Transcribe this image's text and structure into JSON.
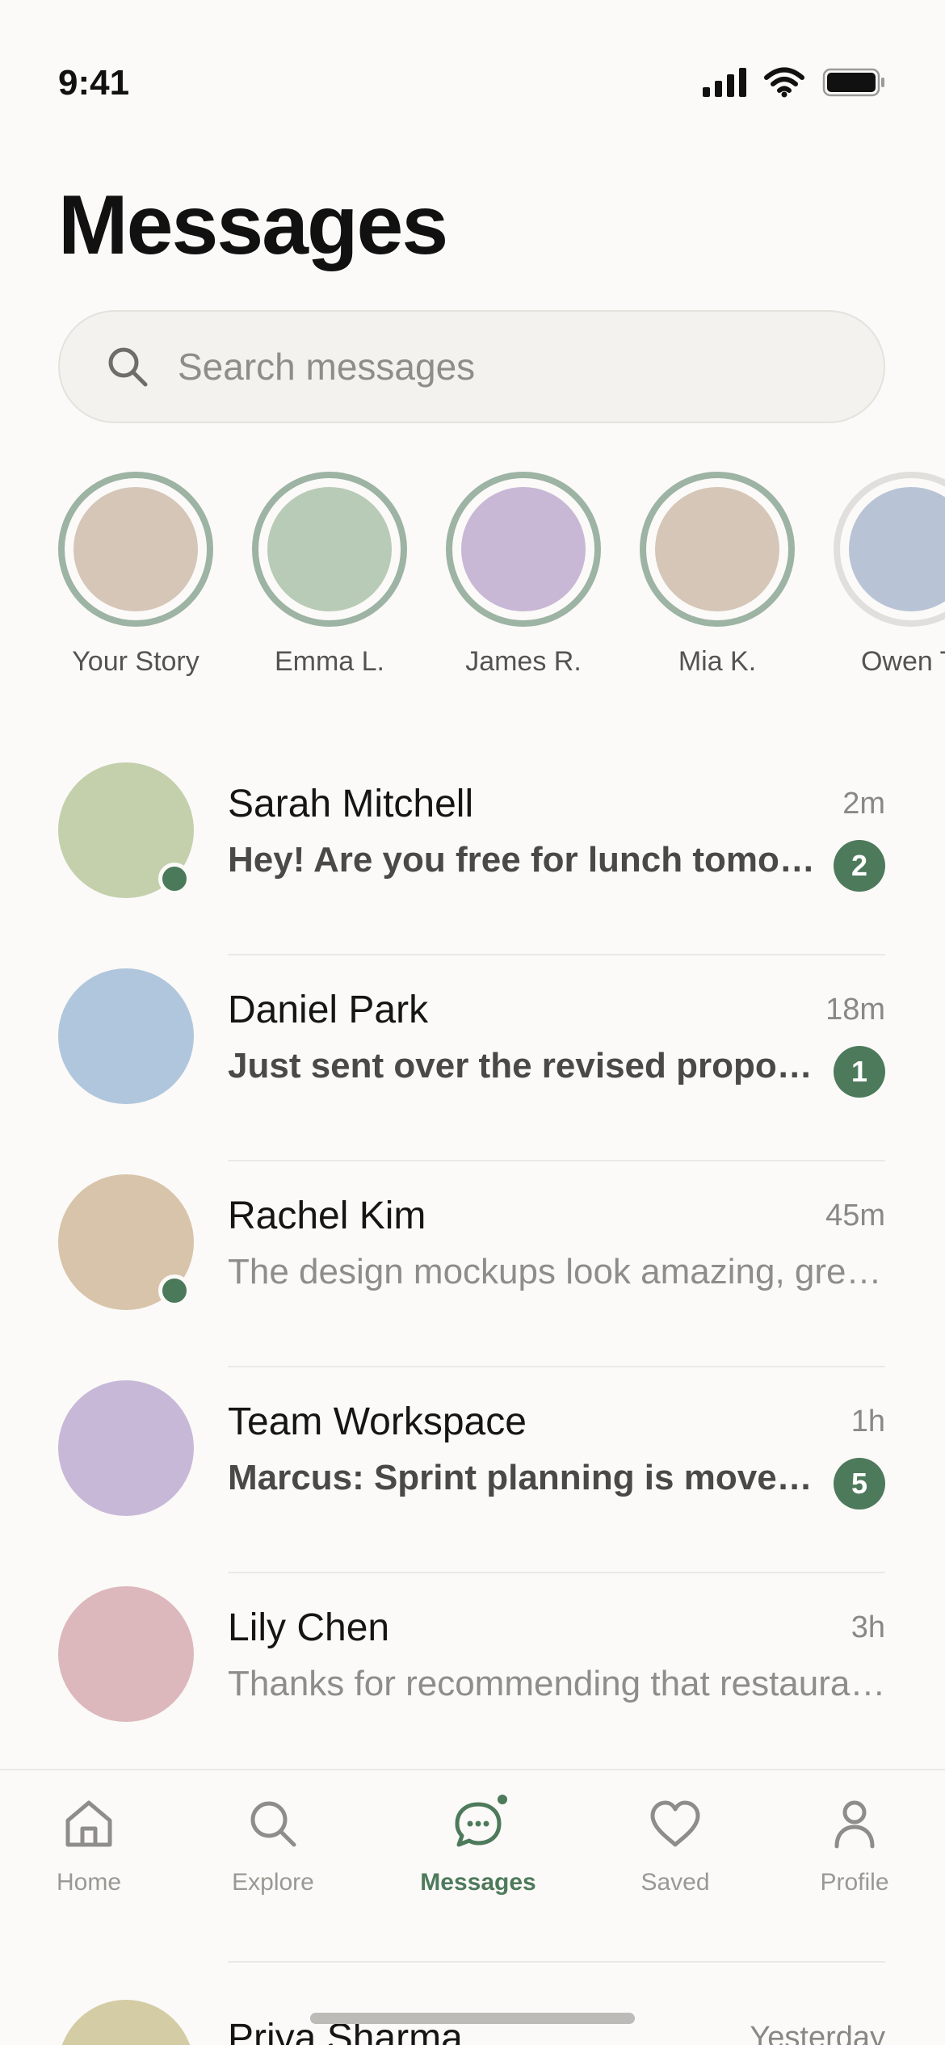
{
  "status_bar": {
    "time": "9:41"
  },
  "header": {
    "title": "Messages"
  },
  "search": {
    "placeholder": "Search messages"
  },
  "stories": [
    {
      "name": "Your Story",
      "color": "#d6c6b8",
      "seen": false
    },
    {
      "name": "Emma L.",
      "color": "#b8cbb6",
      "seen": false
    },
    {
      "name": "James R.",
      "color": "#c8b8d6",
      "seen": false
    },
    {
      "name": "Mia K.",
      "color": "#d6c6b8",
      "seen": false
    },
    {
      "name": "Owen T.",
      "color": "#b8c4d6",
      "seen": true
    }
  ],
  "conversations": [
    {
      "name": "Sarah Mitchell",
      "time": "2m",
      "preview": "Hey! Are you free for lunch tomorrow?",
      "unread_count": "2",
      "online": true,
      "avatar_color": "#c4d0ac"
    },
    {
      "name": "Daniel Park",
      "time": "18m",
      "preview": "Just sent over the revised proposal",
      "unread_count": "1",
      "online": false,
      "avatar_color": "#b0c6dc"
    },
    {
      "name": "Rachel Kim",
      "time": "45m",
      "preview": "The design mockups look amazing, great work!",
      "unread_count": "",
      "online": true,
      "avatar_color": "#d8c4aa"
    },
    {
      "name": "Team Workspace",
      "time": "1h",
      "preview": "Marcus: Sprint planning is moved to Thursday",
      "unread_count": "5",
      "online": false,
      "avatar_color": "#c8b8d8"
    },
    {
      "name": "Lily Chen",
      "time": "3h",
      "preview": "Thanks for recommending that restaurant!",
      "unread_count": "",
      "online": false,
      "avatar_color": "#dcb8bc"
    }
  ],
  "partial_conversation": {
    "name": "Priya Sharma",
    "time": "Yesterday",
    "avatar_color": "#d4cca4"
  },
  "tab_bar": {
    "active": "messages",
    "tabs": [
      {
        "id": "home",
        "label": "Home",
        "icon": "home-icon"
      },
      {
        "id": "explore",
        "label": "Explore",
        "icon": "search-icon"
      },
      {
        "id": "messages",
        "label": "Messages",
        "icon": "chat-bubble-icon"
      },
      {
        "id": "saved",
        "label": "Saved",
        "icon": "heart-icon"
      },
      {
        "id": "profile",
        "label": "Profile",
        "icon": "person-icon"
      }
    ]
  },
  "colors": {
    "accent": "#4e7a5c",
    "background": "#fbfaf8",
    "story_ring": "#9db3a3"
  }
}
